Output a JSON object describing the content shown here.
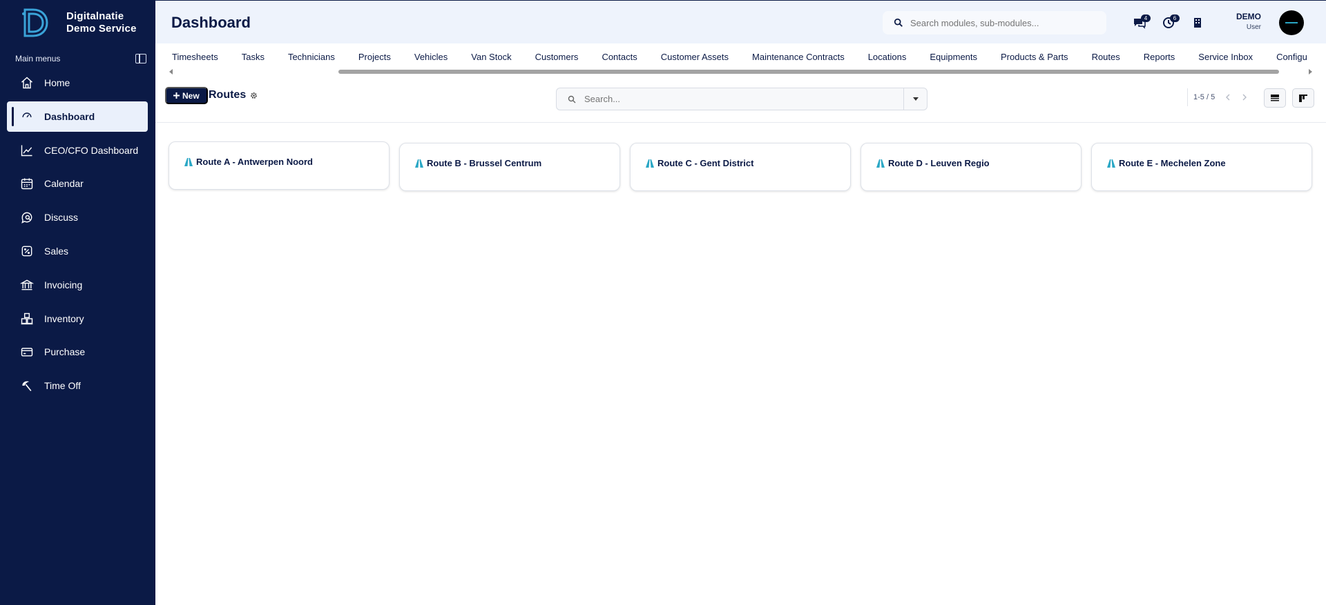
{
  "brand": {
    "line1": "Digitalnatie",
    "line2": "Demo Service"
  },
  "sidebar": {
    "section_label": "Main menus",
    "items": [
      {
        "label": "Home",
        "icon": "home-icon"
      },
      {
        "label": "Dashboard",
        "icon": "gauge-icon",
        "active": true
      },
      {
        "label": "CEO/CFO Dashboard",
        "icon": "chart-line-icon"
      },
      {
        "label": "Calendar",
        "icon": "calendar-icon"
      },
      {
        "label": "Discuss",
        "icon": "chat-icon"
      },
      {
        "label": "Sales",
        "icon": "sales-icon"
      },
      {
        "label": "Invoicing",
        "icon": "bank-icon"
      },
      {
        "label": "Inventory",
        "icon": "boxes-icon"
      },
      {
        "label": "Purchase",
        "icon": "card-icon"
      },
      {
        "label": "Time Off",
        "icon": "umbrella-icon"
      }
    ]
  },
  "header": {
    "title": "Dashboard",
    "search_placeholder": "Search modules, sub-modules...",
    "messages_badge": "4",
    "activities_badge": "6",
    "user_name": "DEMO",
    "user_role": "User"
  },
  "tabs": [
    "Timesheets",
    "Tasks",
    "Technicians",
    "Projects",
    "Vehicles",
    "Van Stock",
    "Customers",
    "Contacts",
    "Customer Assets",
    "Maintenance Contracts",
    "Locations",
    "Equipments",
    "Products & Parts",
    "Routes",
    "Reports",
    "Service Inbox",
    "Configu"
  ],
  "control": {
    "new_label": "New",
    "breadcrumb": "Routes",
    "search_placeholder": "Search...",
    "pager": "1-5 / 5"
  },
  "cards": [
    {
      "label": "Route A - Antwerpen Noord"
    },
    {
      "label": "Route B - Brussel Centrum"
    },
    {
      "label": "Route C - Gent District"
    },
    {
      "label": "Route D - Leuven Regio"
    },
    {
      "label": "Route E - Mechelen Zone"
    }
  ],
  "colors": {
    "sidebar": "#0b1a46",
    "accent": "#2aa7c5",
    "header_bg": "#eef3fc"
  }
}
